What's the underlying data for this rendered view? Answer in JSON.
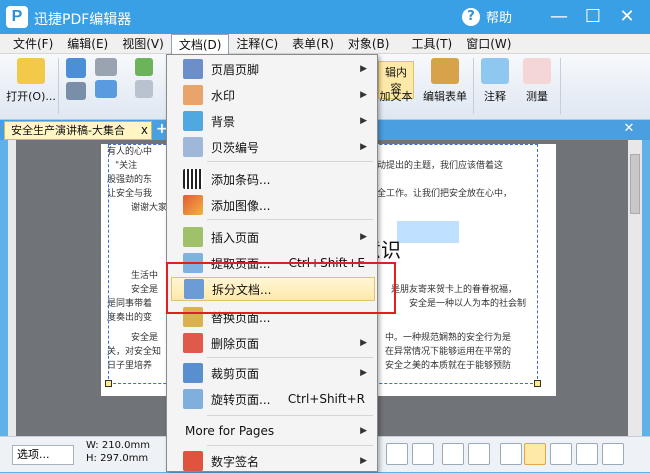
{
  "app": {
    "logo": "P",
    "title": "迅捷PDF编辑器",
    "help": "帮助"
  },
  "window": {
    "minimize": "—",
    "maximize": "☐",
    "close": "✕"
  },
  "menubar": [
    "文件(F)",
    "编辑(E)",
    "视图(V)",
    "文档(D)",
    "注释(C)",
    "表单(R)",
    "对象(B)",
    "工具(T)",
    "窗口(W)"
  ],
  "ribbon": {
    "open": "打开(O)...",
    "edit_content_partial": "辑内容",
    "add_text_partial": "加文本",
    "edit_form": "编辑表单",
    "annotate": "注释",
    "measure": "测量"
  },
  "tab": {
    "name": "安全生产演讲稿-大集合",
    "close": "x",
    "add": "+",
    "close_all": "✕"
  },
  "document": {
    "lines": [
      "有人的心中",
      "\"关注",
      "股强劲的东",
      "让安全与我",
      "谢谢大家",
      "生活中",
      "安全是",
      "是同事带着",
      "度奏出的变",
      "安全是",
      "关，对安全知",
      "日子里培养"
    ],
    "right_lines": [
      "动提出的主题，我们应该借着这",
      "全工作。让我们把安全放在心中，",
      "是朋友寄来贺卡上的眷眷祝福，",
      "安全是一种以人为本的社会制",
      "中。一种规范娴熟的安全行为是",
      "在异常情况下能够运用在平常的",
      "安全之美的本质就在于能够预防"
    ],
    "heading": "意识"
  },
  "dropdown": {
    "items": [
      {
        "label": "页眉页脚",
        "submenu": true
      },
      {
        "label": "水印",
        "submenu": true
      },
      {
        "label": "背景",
        "submenu": true
      },
      {
        "label": "贝茨编号",
        "submenu": true
      },
      {
        "label": "添加条码...",
        "submenu": false
      },
      {
        "label": "添加图像...",
        "submenu": false
      },
      {
        "label": "插入页面",
        "submenu": true
      },
      {
        "label": "提取页面...",
        "shortcut": "Ctrl+Shift+E"
      },
      {
        "label": "拆分文档...",
        "highlight": true
      },
      {
        "label": "替换页面...",
        "submenu": false
      },
      {
        "label": "删除页面",
        "submenu": true
      },
      {
        "label": "裁剪页面",
        "submenu": true
      },
      {
        "label": "旋转页面...",
        "shortcut": "Ctrl+Shift+R"
      },
      {
        "label": "More for Pages",
        "submenu": true
      },
      {
        "label": "数字签名",
        "submenu": true
      }
    ]
  },
  "bottombar": {
    "select": "选项...",
    "width": "W: 210.0mm",
    "height": "H: 297.0mm"
  },
  "colors": {
    "title_bg": "#3aa0e6",
    "highlight_border": "#e02020",
    "selection": "#bfe0ff"
  }
}
